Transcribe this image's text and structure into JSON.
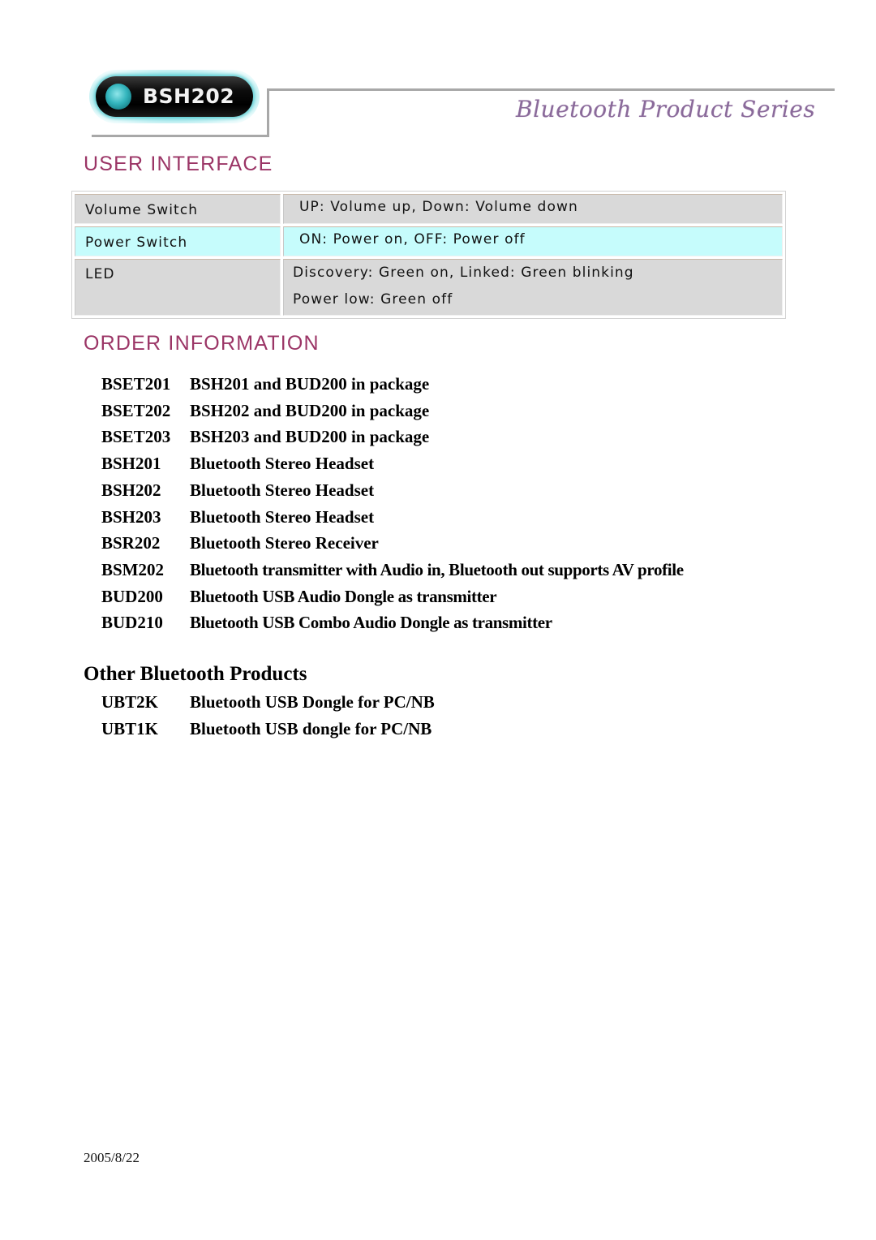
{
  "header": {
    "product_badge": "BSH202",
    "series_title": "Bluetooth Product Series"
  },
  "user_interface": {
    "heading": "USER INTERFACE",
    "rows": [
      {
        "label": "Volume Switch",
        "lines": [
          "UP: Volume up, Down: Volume down"
        ],
        "highlight": false
      },
      {
        "label": "Power Switch",
        "lines": [
          "ON: Power on, OFF: Power off"
        ],
        "highlight": true
      },
      {
        "label": "LED",
        "lines": [
          "Discovery: Green on, Linked: Green blinking",
          "Power low: Green off"
        ],
        "highlight": false
      }
    ],
    "highlight_color": "#c6fcfc",
    "cell_color": "#d9d9d9"
  },
  "order_information": {
    "heading": "ORDER INFORMATION",
    "items": [
      {
        "code": "BSET201",
        "description": "BSH201 and BUD200 in package"
      },
      {
        "code": "BSET202",
        "description": "BSH202 and BUD200 in package"
      },
      {
        "code": "BSET203",
        "description": "BSH203 and BUD200 in package"
      },
      {
        "code": "BSH201",
        "description": "Bluetooth Stereo Headset"
      },
      {
        "code": "BSH202",
        "description": "Bluetooth Stereo Headset"
      },
      {
        "code": "BSH203",
        "description": "Bluetooth Stereo Headset"
      },
      {
        "code": "BSR202",
        "description": "Bluetooth Stereo Receiver"
      },
      {
        "code": "BSM202",
        "description": "Bluetooth transmitter with Audio in, Bluetooth out supports AV profile"
      },
      {
        "code": "BUD200",
        "description": "Bluetooth USB Audio Dongle as transmitter"
      },
      {
        "code": "BUD210",
        "description": "Bluetooth USB Combo Audio Dongle as transmitter"
      }
    ]
  },
  "other_products": {
    "heading": "Other Bluetooth Products",
    "items": [
      {
        "code": "UBT2K",
        "description": "Bluetooth USB Dongle for PC/NB"
      },
      {
        "code": "UBT1K",
        "description": "Bluetooth USB dongle for PC/NB"
      }
    ]
  },
  "footer": {
    "date": "2005/8/22"
  },
  "colors": {
    "heading_accent": "#9b3566",
    "series_title": "#8a6a9a",
    "bracket_line": "#a8a8a8"
  }
}
